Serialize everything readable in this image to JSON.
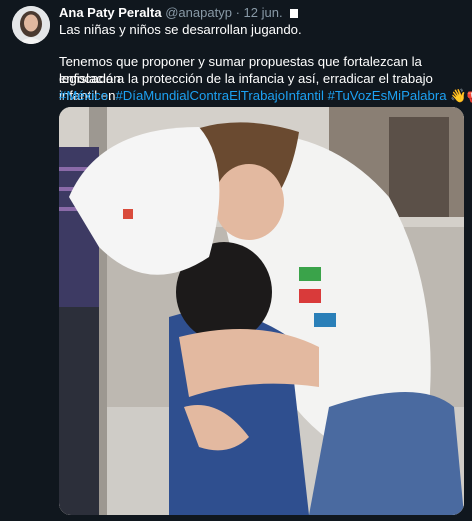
{
  "tweet": {
    "author_name": "Ana Paty Peralta",
    "handle": "@anapatyp",
    "separator": "·",
    "date": "12 jun.",
    "line1": "Las niñas y niños se desarrollan jugando.",
    "line2": "Tenemos que proponer y sumar propuestas que fortalezcan la legislación",
    "line3": "enfocada a la protección de la infancia y así, erradicar el trabajo infantil en",
    "hashtag1": "#México",
    "period": ".",
    "hashtag2": "#DíaMundialContraElTrabajoInfantil",
    "hashtag3": "#TuVozEsMiPalabra",
    "emoji_hand": "👋",
    "emoji_megaphone": "📢"
  },
  "colors": {
    "background": "#10171e",
    "text": "#ffffff",
    "link": "#1da1f2",
    "muted": "#8899a6"
  },
  "icons": [
    "avatar",
    "square-icon",
    "waving-hand-icon",
    "megaphone-icon"
  ]
}
